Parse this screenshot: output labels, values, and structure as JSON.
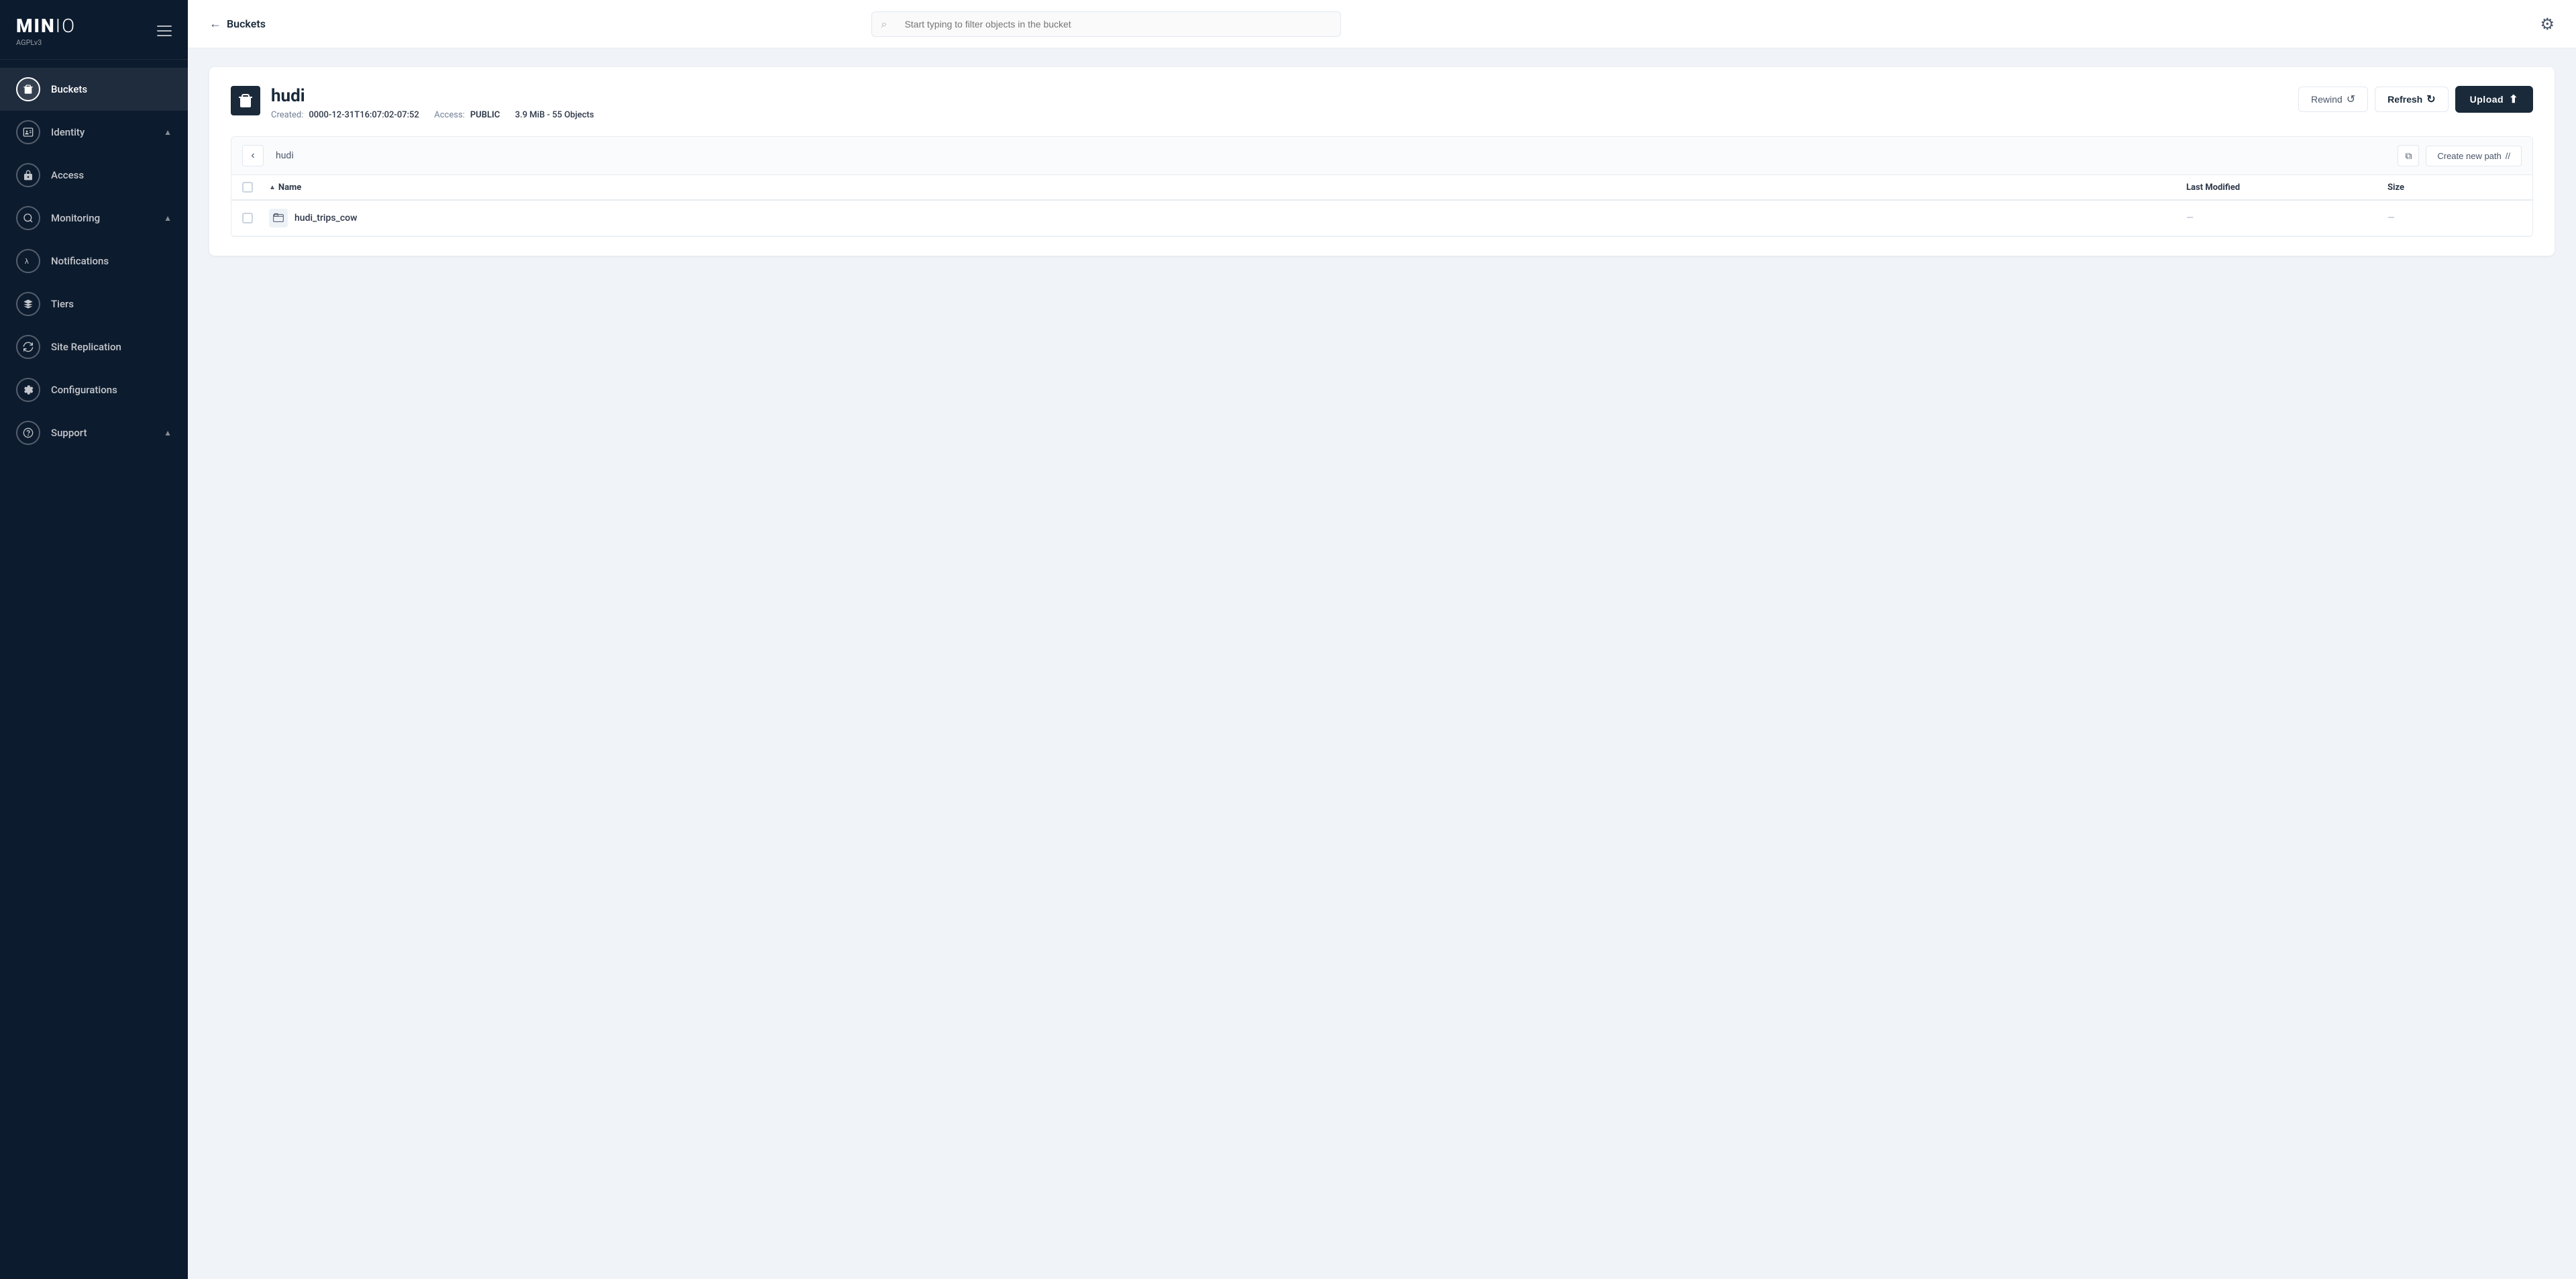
{
  "sidebar": {
    "logo": "MIN IO",
    "version": "AGPLv3",
    "items": [
      {
        "id": "buckets",
        "label": "Buckets",
        "icon": "bucket",
        "active": true,
        "expandable": false
      },
      {
        "id": "identity",
        "label": "Identity",
        "icon": "id-card",
        "active": false,
        "expandable": true
      },
      {
        "id": "access",
        "label": "Access",
        "icon": "lock",
        "active": false,
        "expandable": false
      },
      {
        "id": "monitoring",
        "label": "Monitoring",
        "icon": "chart",
        "active": false,
        "expandable": true
      },
      {
        "id": "notifications",
        "label": "Notifications",
        "icon": "lambda",
        "active": false,
        "expandable": false
      },
      {
        "id": "tiers",
        "label": "Tiers",
        "icon": "layers",
        "active": false,
        "expandable": false
      },
      {
        "id": "site-replication",
        "label": "Site Replication",
        "icon": "replication",
        "active": false,
        "expandable": false
      },
      {
        "id": "configurations",
        "label": "Configurations",
        "icon": "gear",
        "active": false,
        "expandable": false
      },
      {
        "id": "support",
        "label": "Support",
        "icon": "support",
        "active": false,
        "expandable": true
      }
    ]
  },
  "topbar": {
    "back_label": "Buckets",
    "search_placeholder": "Start typing to filter objects in the bucket"
  },
  "bucket": {
    "name": "hudi",
    "created_label": "Created:",
    "created_value": "0000-12-31T16:07:02-07:52",
    "access_label": "Access:",
    "access_value": "PUBLIC",
    "storage_info": "3.9 MiB - 55 Objects",
    "path": "hudi",
    "buttons": {
      "rewind": "Rewind",
      "refresh": "Refresh",
      "upload": "Upload"
    },
    "table": {
      "columns": [
        "Name",
        "Last Modified",
        "Size"
      ],
      "rows": [
        {
          "name": "hudi_trips_cow",
          "last_modified": "",
          "size": ""
        }
      ]
    },
    "create_path_label": "Create new path",
    "create_path_icon": "//",
    "copy_icon": "copy"
  }
}
